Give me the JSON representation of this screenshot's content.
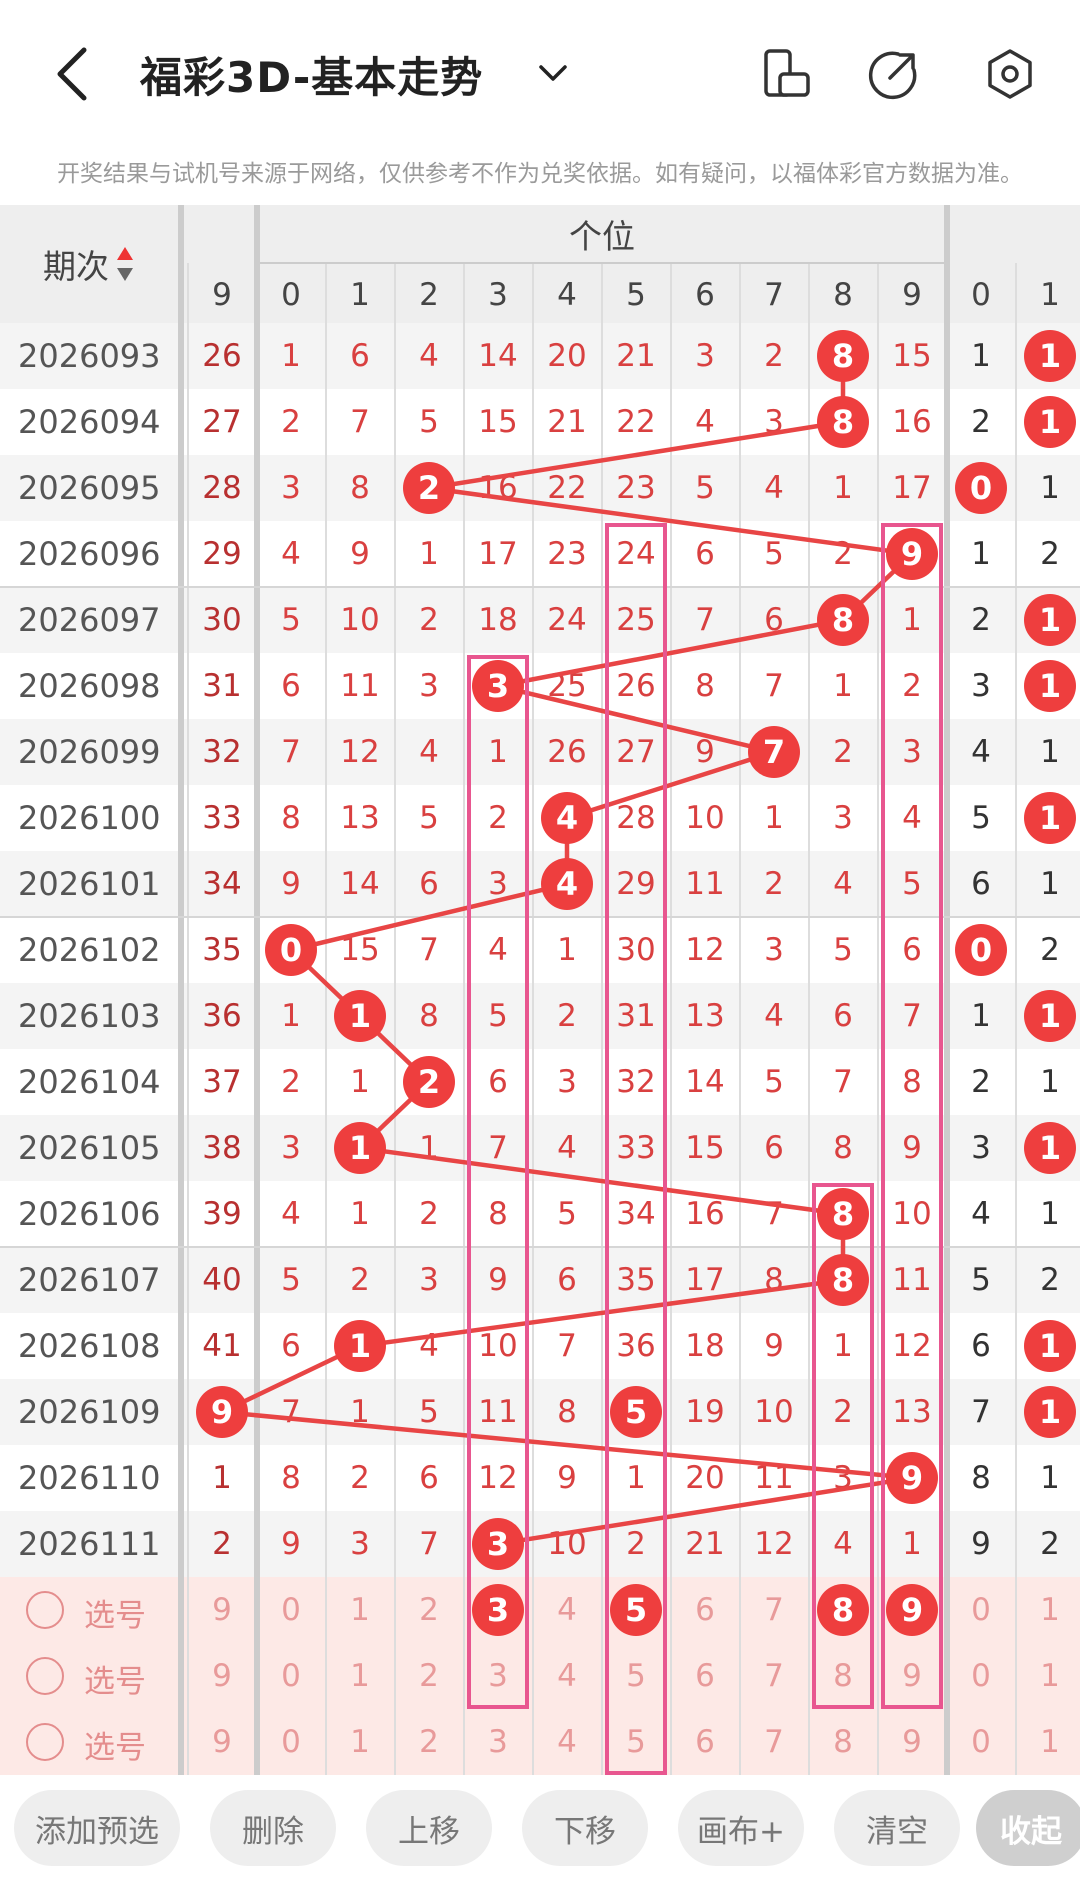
{
  "header": {
    "title": "福彩3D-基本走势",
    "back_icon": "chevron-left-icon",
    "dropdown_icon": "chevron-down-icon",
    "icons": [
      "phone-rotate-icon",
      "share-icon",
      "settings-icon"
    ]
  },
  "notice": "开奖结果与试机号来源于网络，仅供参考不作为兑奖依据。如有疑问，以福体彩官方数据为准。",
  "table": {
    "period_header": "期次",
    "group_header": "个位",
    "columns": [
      "9",
      "0",
      "1",
      "2",
      "3",
      "4",
      "5",
      "6",
      "7",
      "8",
      "9",
      "0",
      "1"
    ],
    "rows": [
      {
        "period": "2026093",
        "cells": [
          "26",
          "1",
          "6",
          "4",
          "14",
          "20",
          "21",
          "3",
          "2",
          "8",
          "15",
          "1",
          "1"
        ],
        "ball": 9,
        "right_ball": true
      },
      {
        "period": "2026094",
        "cells": [
          "27",
          "2",
          "7",
          "5",
          "15",
          "21",
          "22",
          "4",
          "3",
          "8",
          "16",
          "2",
          "1"
        ],
        "ball": 9,
        "right_ball": true
      },
      {
        "period": "2026095",
        "cells": [
          "28",
          "3",
          "8",
          "2",
          "16",
          "22",
          "23",
          "5",
          "4",
          "1",
          "17",
          "0",
          "1"
        ],
        "ball": 3,
        "right_ball0": true
      },
      {
        "period": "2026096",
        "cells": [
          "29",
          "4",
          "9",
          "1",
          "17",
          "23",
          "24",
          "6",
          "5",
          "2",
          "9",
          "1",
          "2"
        ],
        "ball": 10
      },
      {
        "period": "2026097",
        "cells": [
          "30",
          "5",
          "10",
          "2",
          "18",
          "24",
          "25",
          "7",
          "6",
          "8",
          "1",
          "2",
          "1"
        ],
        "ball": 9,
        "right_ball": true
      },
      {
        "period": "2026098",
        "cells": [
          "31",
          "6",
          "11",
          "3",
          "3",
          "25",
          "26",
          "8",
          "7",
          "1",
          "2",
          "3",
          "1"
        ],
        "ball": 4,
        "right_ball": true
      },
      {
        "period": "2026099",
        "cells": [
          "32",
          "7",
          "12",
          "4",
          "1",
          "26",
          "27",
          "9",
          "7",
          "2",
          "3",
          "4",
          "1"
        ],
        "ball": 8
      },
      {
        "period": "2026100",
        "cells": [
          "33",
          "8",
          "13",
          "5",
          "2",
          "4",
          "28",
          "10",
          "1",
          "3",
          "4",
          "5",
          "1"
        ],
        "ball": 5,
        "right_ball": true
      },
      {
        "period": "2026101",
        "cells": [
          "34",
          "9",
          "14",
          "6",
          "3",
          "4",
          "29",
          "11",
          "2",
          "4",
          "5",
          "6",
          "1"
        ],
        "ball": 5
      },
      {
        "period": "2026102",
        "cells": [
          "35",
          "0",
          "15",
          "7",
          "4",
          "1",
          "30",
          "12",
          "3",
          "5",
          "6",
          "0",
          "2"
        ],
        "ball": 1,
        "right_ball0": true
      },
      {
        "period": "2026103",
        "cells": [
          "36",
          "1",
          "1",
          "8",
          "5",
          "2",
          "31",
          "13",
          "4",
          "6",
          "7",
          "1",
          "1"
        ],
        "ball": 2,
        "right_ball": true
      },
      {
        "period": "2026104",
        "cells": [
          "37",
          "2",
          "1",
          "2",
          "6",
          "3",
          "32",
          "14",
          "5",
          "7",
          "8",
          "2",
          "1"
        ],
        "ball": 3
      },
      {
        "period": "2026105",
        "cells": [
          "38",
          "3",
          "1",
          "1",
          "7",
          "4",
          "33",
          "15",
          "6",
          "8",
          "9",
          "3",
          "1"
        ],
        "ball": 2,
        "right_ball": true
      },
      {
        "period": "2026106",
        "cells": [
          "39",
          "4",
          "1",
          "2",
          "8",
          "5",
          "34",
          "16",
          "7",
          "8",
          "10",
          "4",
          "1"
        ],
        "ball": 9
      },
      {
        "period": "2026107",
        "cells": [
          "40",
          "5",
          "2",
          "3",
          "9",
          "6",
          "35",
          "17",
          "8",
          "8",
          "11",
          "5",
          "2"
        ],
        "ball": 9
      },
      {
        "period": "2026108",
        "cells": [
          "41",
          "6",
          "1",
          "4",
          "10",
          "7",
          "36",
          "18",
          "9",
          "1",
          "12",
          "6",
          "1"
        ],
        "ball": 2,
        "right_ball": true
      },
      {
        "period": "2026109",
        "cells": [
          "9",
          "7",
          "1",
          "5",
          "11",
          "8",
          "5",
          "19",
          "10",
          "2",
          "13",
          "7",
          "1"
        ],
        "ball": 0,
        "right_ball": true,
        "extra_ball": 6
      },
      {
        "period": "2026110",
        "cells": [
          "1",
          "8",
          "2",
          "6",
          "12",
          "9",
          "1",
          "20",
          "11",
          "3",
          "9",
          "8",
          "1"
        ],
        "ball": 10
      },
      {
        "period": "2026111",
        "cells": [
          "2",
          "9",
          "3",
          "7",
          "3",
          "10",
          "2",
          "21",
          "12",
          "4",
          "1",
          "9",
          "2"
        ],
        "ball": 4
      }
    ],
    "preselect_label": "选号",
    "preselect_values": [
      "9",
      "0",
      "1",
      "2",
      "3",
      "4",
      "5",
      "6",
      "7",
      "8",
      "9",
      "0",
      "1"
    ],
    "preselect_rows": 3,
    "preselect_balls": [
      4,
      6,
      9,
      10
    ]
  },
  "toolbar": {
    "add": "添加预选",
    "delete": "删除",
    "up": "上移",
    "down": "下移",
    "canvas": "画布+",
    "clear": "清空",
    "collapse": "收起"
  },
  "colors": {
    "accent": "#ee3e3e",
    "highlight_box": "#e8568f",
    "preselect_bg": "#fde9e6"
  }
}
